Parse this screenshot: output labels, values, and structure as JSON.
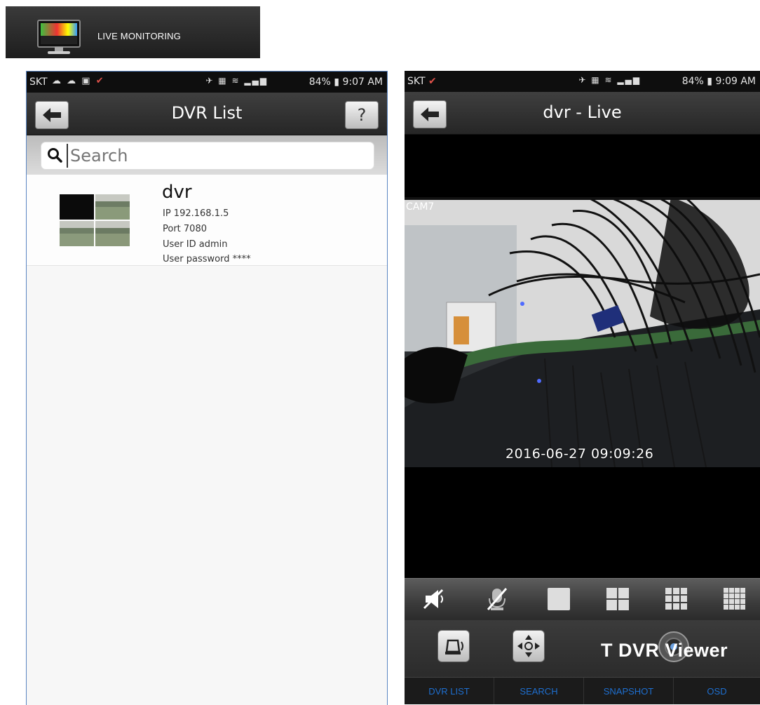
{
  "banner": {
    "label": "LIVE MONITORING",
    "icon": "monitor-icon"
  },
  "screen1": {
    "status": {
      "carrier": "SKT",
      "battery": "84%",
      "time": "9:07 AM"
    },
    "title": "DVR List",
    "back_icon": "back-arrow-icon",
    "help_label": "?",
    "search": {
      "placeholder": "Search"
    },
    "dvr": {
      "name": "dvr",
      "ip": "IP 192.168.1.5",
      "port": "Port 7080",
      "user": "User ID admin",
      "password": "User password ****"
    }
  },
  "screen2": {
    "status": {
      "carrier": "SKT",
      "battery": "84%",
      "time": "9:09 AM"
    },
    "title": "dvr - Live",
    "back_icon": "back-arrow-icon",
    "cam_label": "CAM7",
    "timestamp": "2016-06-27 09:09:26",
    "controls": [
      "mute-icon",
      "mic-off-icon",
      "single-view-icon",
      "quad-view-icon",
      "nine-view-icon",
      "sixteen-view-icon"
    ],
    "buttons": [
      "alarm-icon",
      "ptz-icon"
    ],
    "brand": "T DVR Viewer",
    "tabs": [
      "DVR LIST",
      "SEARCH",
      "SNAPSHOT",
      "OSD"
    ],
    "tab_color": "#1e6fd0"
  }
}
